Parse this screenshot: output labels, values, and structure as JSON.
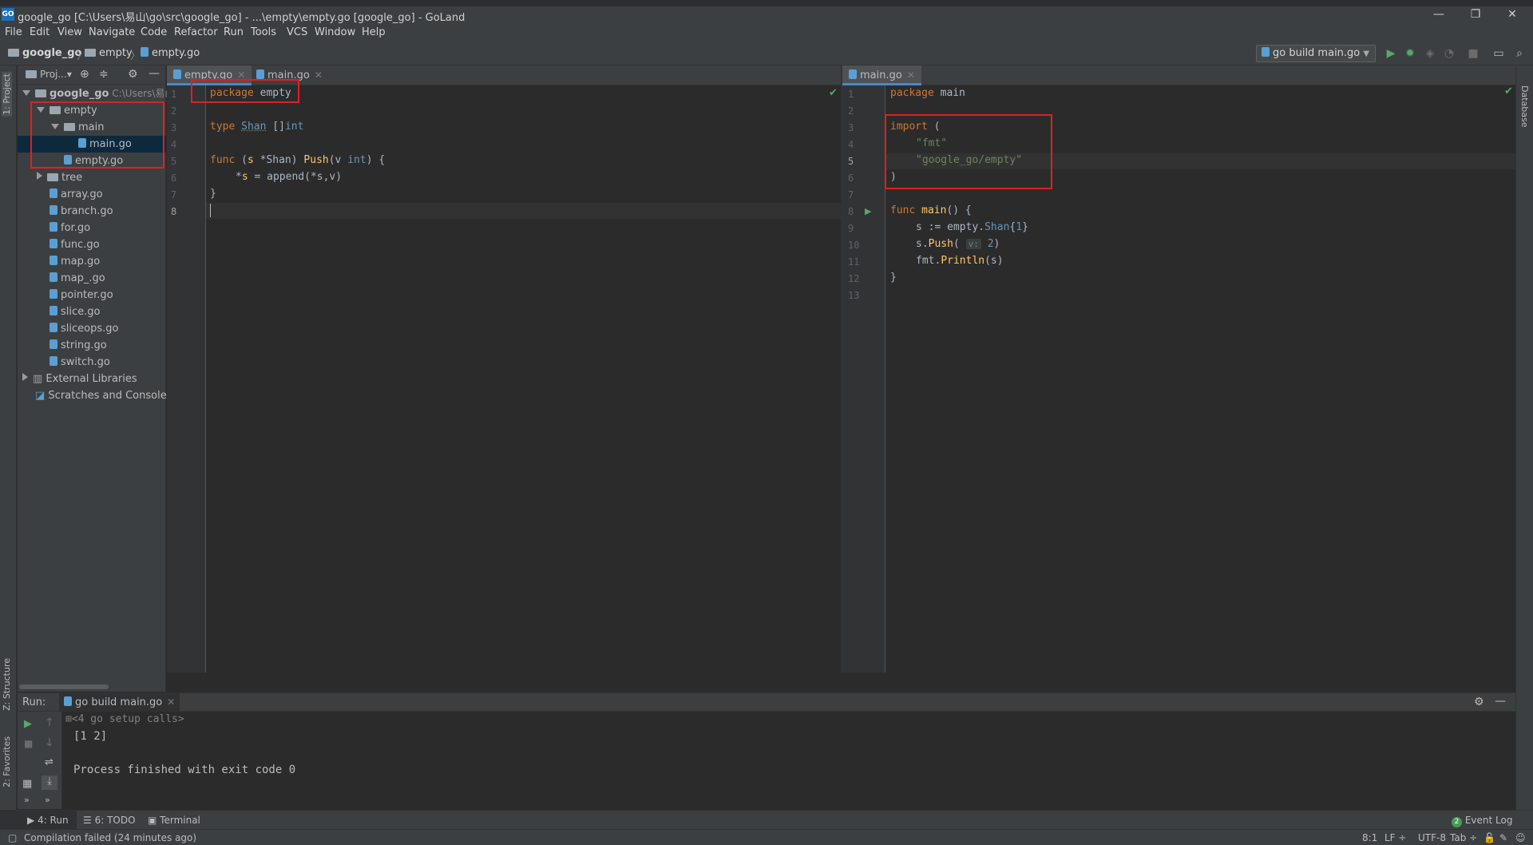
{
  "window": {
    "title": "google_go [C:\\Users\\易山\\go\\src\\google_go] - ...\\empty\\empty.go [google_go] - GoLand",
    "app_icon": "GO"
  },
  "menu": [
    "File",
    "Edit",
    "View",
    "Navigate",
    "Code",
    "Refactor",
    "Run",
    "Tools",
    "VCS",
    "Window",
    "Help"
  ],
  "breadcrumb": [
    "google_go",
    "empty",
    "empty.go"
  ],
  "run_config": "go build main.go",
  "left_strip": {
    "project": "1: Project",
    "structure": "Z: Structure",
    "favorites": "2: Favorites"
  },
  "right_strip": {
    "database": "Database"
  },
  "project_panel": {
    "header_label": "Proj...",
    "tree": [
      {
        "label": "google_go",
        "extra": "C:\\Users\\易山",
        "indent": 0,
        "kind": "folder",
        "open": true
      },
      {
        "label": "empty",
        "indent": 1,
        "kind": "folder",
        "open": true
      },
      {
        "label": "main",
        "indent": 2,
        "kind": "folder",
        "open": true
      },
      {
        "label": "main.go",
        "indent": 3,
        "kind": "file",
        "selected": true
      },
      {
        "label": "empty.go",
        "indent": 2,
        "kind": "file"
      },
      {
        "label": "tree",
        "indent": 1,
        "kind": "folder",
        "open": false
      },
      {
        "label": "array.go",
        "indent": 1,
        "kind": "file"
      },
      {
        "label": "branch.go",
        "indent": 1,
        "kind": "file"
      },
      {
        "label": "for.go",
        "indent": 1,
        "kind": "file"
      },
      {
        "label": "func.go",
        "indent": 1,
        "kind": "file"
      },
      {
        "label": "map.go",
        "indent": 1,
        "kind": "file"
      },
      {
        "label": "map_.go",
        "indent": 1,
        "kind": "file"
      },
      {
        "label": "pointer.go",
        "indent": 1,
        "kind": "file"
      },
      {
        "label": "slice.go",
        "indent": 1,
        "kind": "file"
      },
      {
        "label": "sliceops.go",
        "indent": 1,
        "kind": "file"
      },
      {
        "label": "string.go",
        "indent": 1,
        "kind": "file"
      },
      {
        "label": "switch.go",
        "indent": 1,
        "kind": "file"
      },
      {
        "label": "External Libraries",
        "indent": 0,
        "kind": "lib",
        "open": false
      },
      {
        "label": "Scratches and Consoles",
        "indent": 0,
        "kind": "scratch"
      }
    ]
  },
  "editor_left": {
    "tabs": [
      {
        "label": "empty.go",
        "active": true
      },
      {
        "label": "main.go",
        "active": false
      }
    ],
    "line_numbers": [
      "1",
      "2",
      "3",
      "4",
      "5",
      "6",
      "7",
      "8"
    ]
  },
  "editor_right": {
    "tabs": [
      {
        "label": "main.go",
        "active": true
      }
    ],
    "line_numbers": [
      "1",
      "2",
      "3",
      "4",
      "5",
      "6",
      "7",
      "8",
      "9",
      "10",
      "11",
      "12",
      "13"
    ]
  },
  "code_tokens": {
    "l_package": "package",
    "l_empty": "empty",
    "l_type": "type",
    "l_shan": "Shan",
    "l_slice": "[]",
    "l_int": "int",
    "l_func": "func",
    "l_recv_open": "(",
    "l_s": "s",
    "l_star_shan": " *Shan) ",
    "l_push": "Push",
    "l_params": "(v ",
    "l_int2": "int",
    "l_brace": ") {",
    "l_body_star": "*",
    "l_body_s": "s",
    "l_body_rest": " = append(*s,v)",
    "l_close": "}",
    "r_package": "package",
    "r_main": "main",
    "r_import": "import",
    "r_paren": " (",
    "r_fmt": "\"fmt\"",
    "r_empty_pkg": "\"google_go/empty\"",
    "r_paren_close": ")",
    "r_func": "func",
    "r_mainfn": "main",
    "r_main_rest": "() {",
    "r_s1a": "s := empty.",
    "r_s1b": "Shan",
    "r_s1c": "{",
    "r_s1d": "1",
    "r_s1e": "}",
    "r_s2a": "s.",
    "r_s2b": "Push",
    "r_s2c": "( ",
    "r_hint": "v:",
    "r_s2d": " ",
    "r_s2e": "2",
    "r_s2f": ")",
    "r_s3a": "fmt.",
    "r_s3b": "Println",
    "r_s3c": "(s)",
    "r_close": "}"
  },
  "run_panel": {
    "label": "Run:",
    "tab": "go build main.go",
    "output": [
      "<4 go setup calls>",
      "[1 2]",
      "",
      "Process finished with exit code 0"
    ]
  },
  "bottom_tabs": {
    "run": "4: Run",
    "todo": "6: TODO",
    "terminal": "Terminal",
    "event_log": "Event Log",
    "event_count": "2"
  },
  "status": {
    "message": "Compilation failed (24 minutes ago)",
    "position": "8:1",
    "line_sep": "LF ÷",
    "encoding": "UTF-8",
    "indent": "Tab ÷"
  }
}
